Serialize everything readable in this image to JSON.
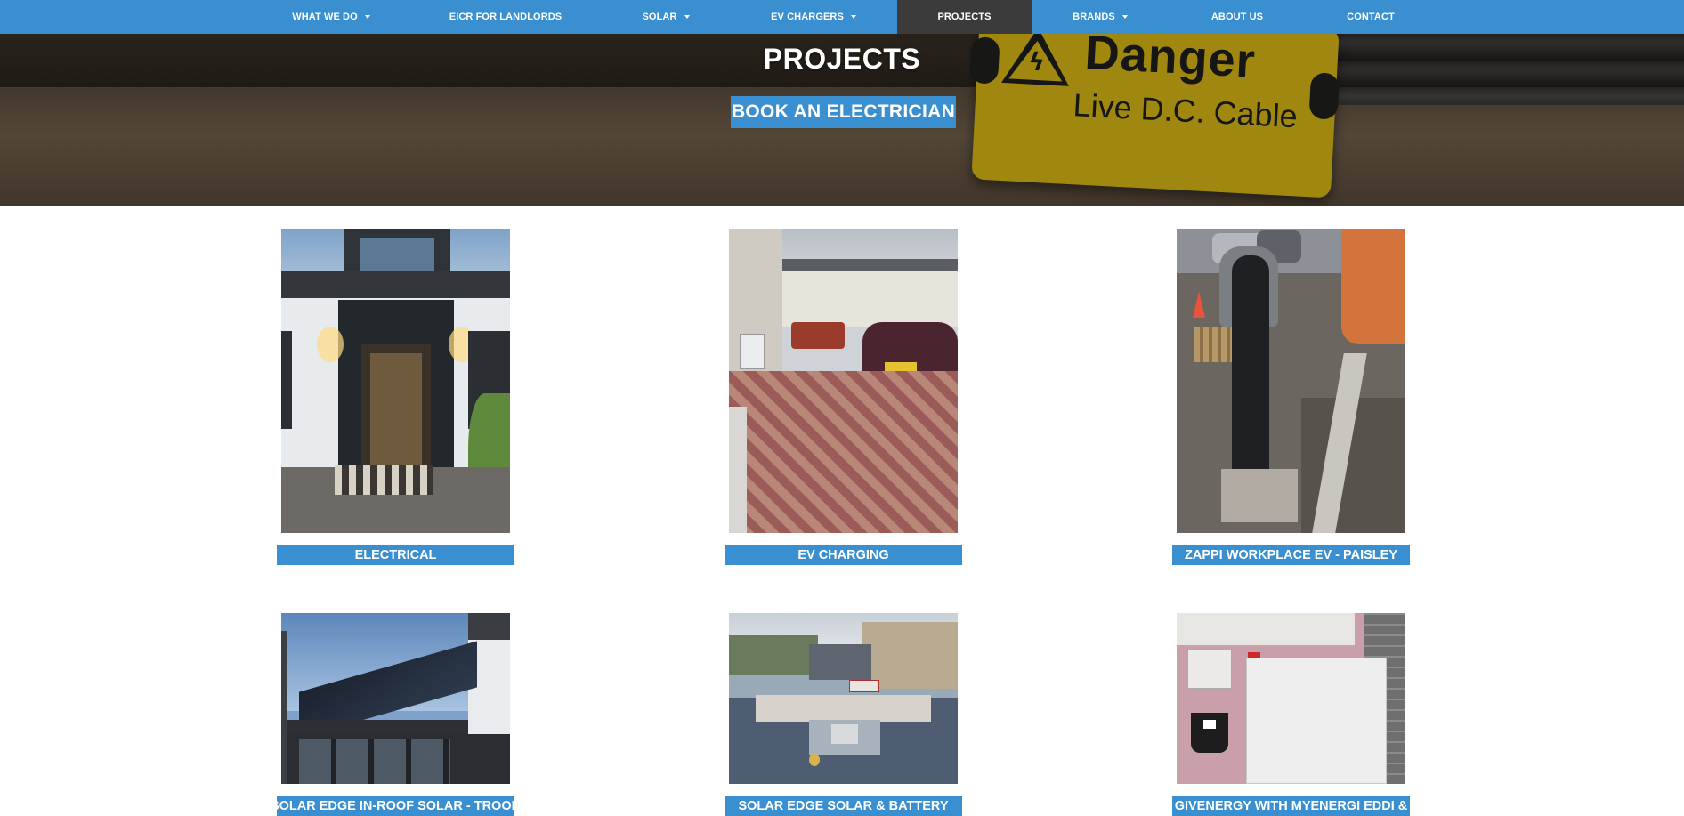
{
  "nav": {
    "items": [
      {
        "label": "WHAT WE DO",
        "dropdown": true
      },
      {
        "label": "EICR FOR LANDLORDS",
        "dropdown": false
      },
      {
        "label": "SOLAR",
        "dropdown": true
      },
      {
        "label": "EV CHARGERS",
        "dropdown": true
      },
      {
        "label": "PROJECTS",
        "dropdown": false,
        "active": true
      },
      {
        "label": "BRANDS",
        "dropdown": true
      },
      {
        "label": "ABOUT US",
        "dropdown": false
      },
      {
        "label": "CONTACT",
        "dropdown": false
      }
    ]
  },
  "hero": {
    "title": "PROJECTS",
    "button_label": "BOOK AN ELECTRICIAN",
    "sign_title": "Danger",
    "sign_subtitle": "Live D.C. Cable"
  },
  "projects": [
    {
      "label": "ELECTRICAL"
    },
    {
      "label": "EV CHARGING"
    },
    {
      "label": "ZAPPI WORKPLACE EV - PAISLEY"
    },
    {
      "label": "SOLAR EDGE IN-ROOF SOLAR - TROON"
    },
    {
      "label": "SOLAR EDGE SOLAR & BATTERY"
    },
    {
      "label": "GIVENERGY WITH MYENERGI EDDI &"
    }
  ],
  "colors": {
    "brand_blue": "#3a8fd0",
    "nav_active": "#3b3b3b",
    "sign_yellow": "#f2cc16"
  }
}
